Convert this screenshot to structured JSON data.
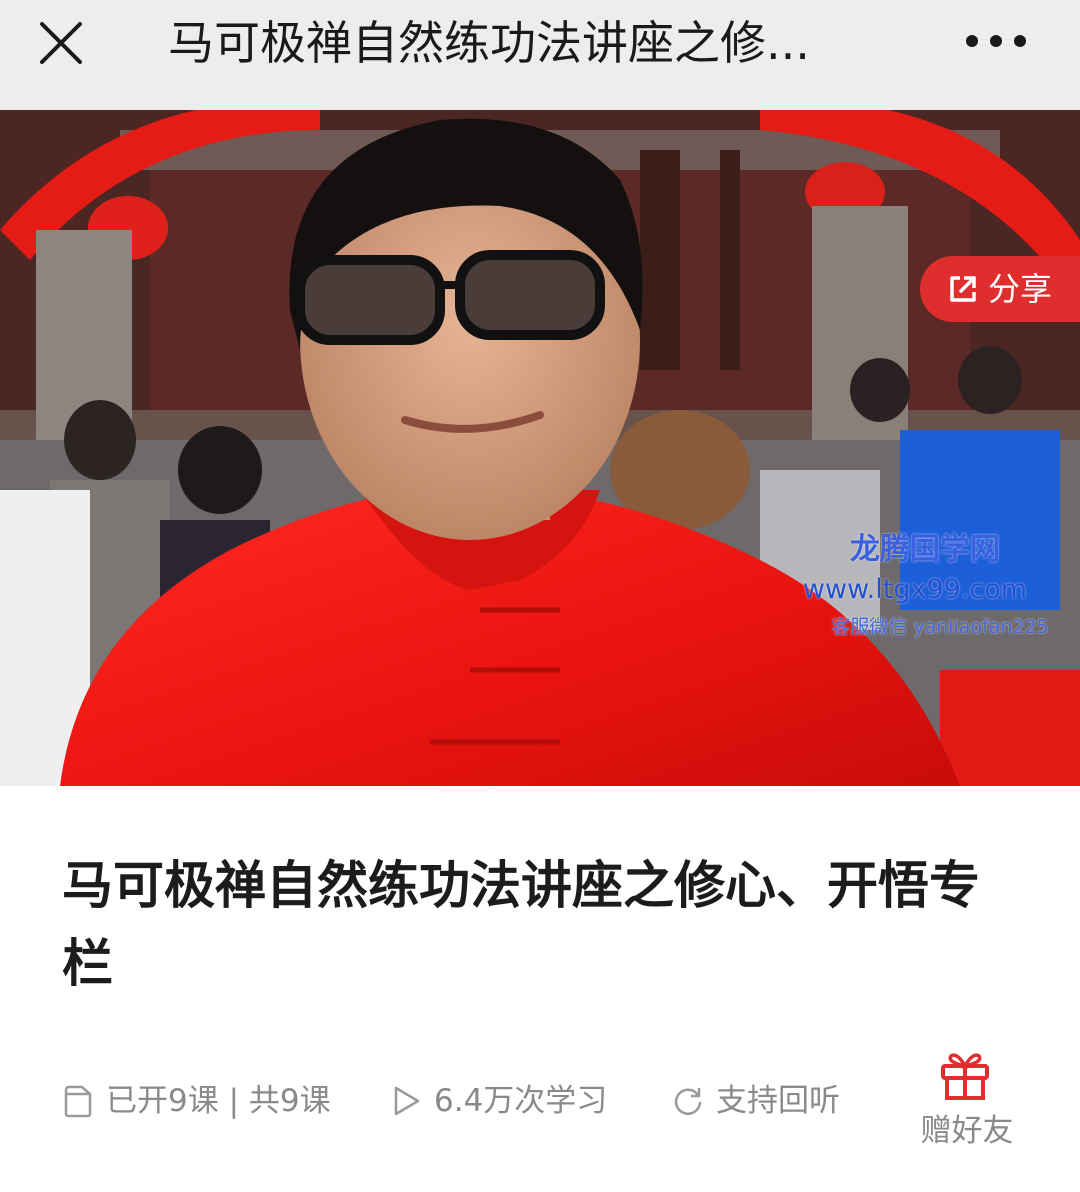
{
  "nav": {
    "title": "马可极禅自然练功法讲座之修...",
    "close_icon": "close-icon",
    "more_icon": "more-dots-icon"
  },
  "hero": {
    "share_label": "分享",
    "share_icon": "external-share-icon",
    "watermark": {
      "name": "龙腾国学网",
      "url": "www.ltgx99.com",
      "contact": "客服微信 yanliaofan225"
    }
  },
  "course": {
    "title": "马可极禅自然练功法讲座之修心、开悟专栏"
  },
  "meta": {
    "lessons": "已开9课 | 共9课",
    "plays": "6.4万次学习",
    "replay": "支持回听",
    "lessons_icon": "document-icon",
    "plays_icon": "play-icon",
    "replay_icon": "refresh-icon"
  },
  "gift": {
    "label": "赠好友",
    "icon": "gift-icon"
  },
  "colors": {
    "accent": "#e02e2e",
    "nav_bg": "#ededed",
    "meta_text": "#8a8a8a"
  }
}
